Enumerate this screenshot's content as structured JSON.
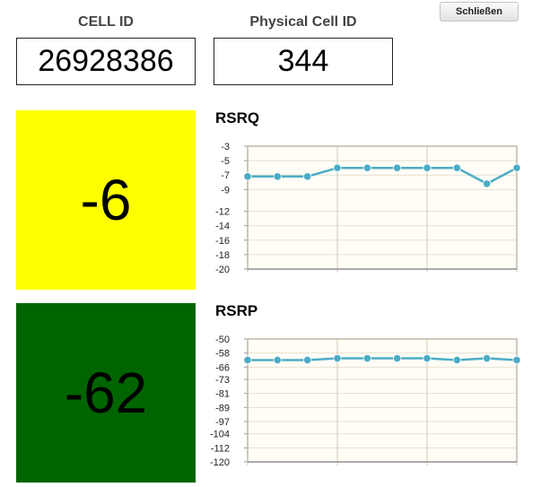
{
  "header": {
    "cell_id_label": "CELL ID",
    "physical_cell_id_label": "Physical Cell ID",
    "close_label": "Schließen"
  },
  "values": {
    "cell_id": "26928386",
    "physical_cell_id": "344",
    "rsrq": "-6",
    "rsrp": "-62"
  },
  "colors": {
    "rsrq_tile": "#ffff00",
    "rsrp_tile": "#006400",
    "series_line": "#4bacc6",
    "plot_background": "#fffdf6"
  },
  "chart_data": [
    {
      "type": "line",
      "title": "RSRQ",
      "ylim": [
        -20,
        -3
      ],
      "yticks": [
        -3,
        -5,
        -7,
        -9,
        -12,
        -14,
        -16,
        -18,
        -20
      ],
      "x": [
        1,
        2,
        3,
        4,
        5,
        6,
        7,
        8,
        9,
        10
      ],
      "values": [
        -7.2,
        -7.2,
        -7.2,
        -6,
        -6,
        -6,
        -6,
        -6,
        -8.2,
        -6
      ],
      "grid": true
    },
    {
      "type": "line",
      "title": "RSRP",
      "ylim": [
        -120,
        -50
      ],
      "yticks": [
        -50,
        -58,
        -66,
        -73,
        -81,
        -89,
        -97,
        -104,
        -112,
        -120
      ],
      "x": [
        1,
        2,
        3,
        4,
        5,
        6,
        7,
        8,
        9,
        10
      ],
      "values": [
        -62,
        -62,
        -62,
        -61,
        -61,
        -61,
        -61,
        -62,
        -61,
        -62
      ],
      "grid": true
    }
  ]
}
